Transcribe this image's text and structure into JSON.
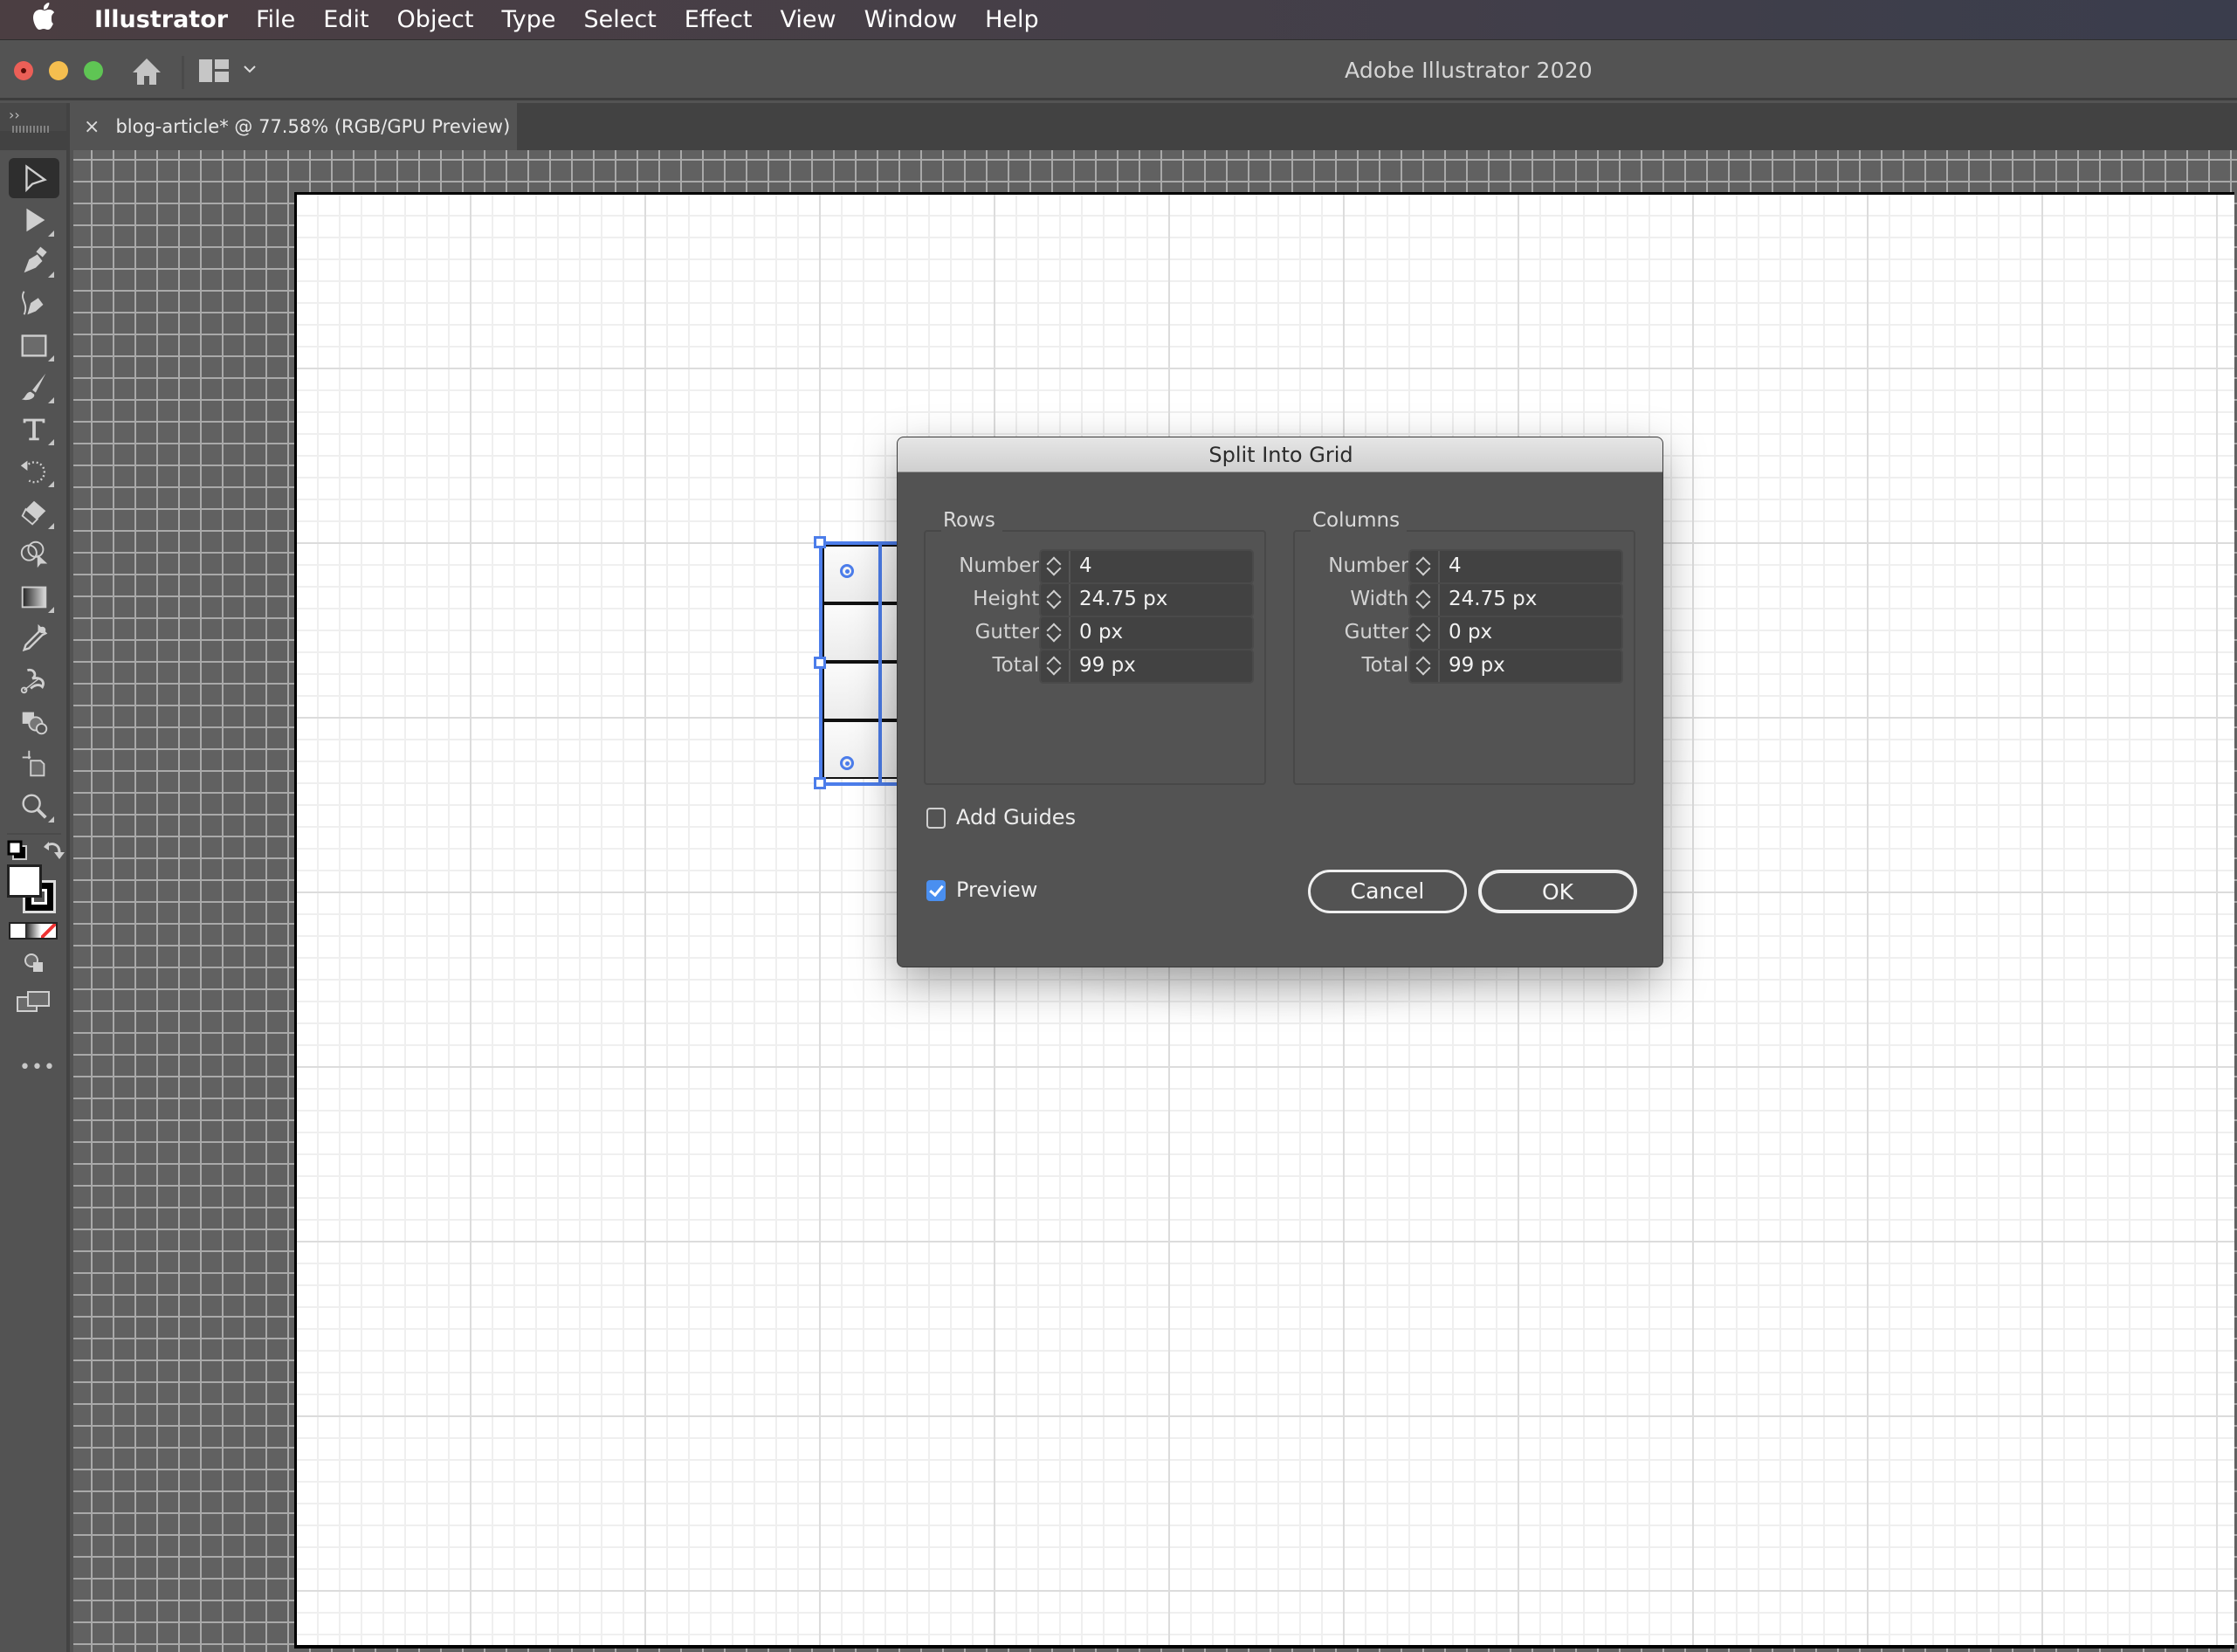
{
  "menubar": {
    "apple_icon": "apple-logo",
    "app_name": "Illustrator",
    "items": [
      "File",
      "Edit",
      "Object",
      "Type",
      "Select",
      "Effect",
      "View",
      "Window",
      "Help"
    ]
  },
  "titlebar": {
    "app_title": "Adobe Illustrator 2020",
    "icons": [
      "home-icon",
      "workspace-switcher-icon",
      "chevron-down-icon"
    ]
  },
  "tabs": {
    "collapse_label": "››",
    "document_tab": {
      "close_label": "×",
      "title": "blog-article* @ 77.58% (RGB/GPU Preview)"
    }
  },
  "toolbar": {
    "tools": [
      {
        "name": "selection-tool",
        "active": true
      },
      {
        "name": "direct-selection-tool",
        "active": false
      },
      {
        "name": "pen-tool",
        "active": false
      },
      {
        "name": "curvature-tool",
        "active": false
      },
      {
        "name": "rectangle-tool",
        "active": false
      },
      {
        "name": "paintbrush-tool",
        "active": false
      },
      {
        "name": "type-tool",
        "active": false
      },
      {
        "name": "rotate-tool",
        "active": false
      },
      {
        "name": "eraser-tool",
        "active": false
      },
      {
        "name": "shape-builder-tool",
        "active": false
      },
      {
        "name": "gradient-tool",
        "active": false
      },
      {
        "name": "eyedropper-tool",
        "active": false
      },
      {
        "name": "puppet-warp-tool",
        "active": false
      },
      {
        "name": "live-paint-tool",
        "active": false
      },
      {
        "name": "artboard-tool",
        "active": false
      },
      {
        "name": "zoom-tool",
        "active": false
      }
    ],
    "fill_color": "#ffffff",
    "stroke_color": "#000000",
    "more_label": "•••"
  },
  "canvas": {
    "selected_object": {
      "rows": 4,
      "columns": 4
    }
  },
  "dialog": {
    "title": "Split Into Grid",
    "rows": {
      "legend": "Rows",
      "fields": [
        {
          "label": "Number:",
          "value": "4"
        },
        {
          "label": "Height:",
          "value": "24.75 px"
        },
        {
          "label": "Gutter:",
          "value": "0 px"
        },
        {
          "label": "Total:",
          "value": "99 px"
        }
      ]
    },
    "columns": {
      "legend": "Columns",
      "fields": [
        {
          "label": "Number:",
          "value": "4"
        },
        {
          "label": "Width:",
          "value": "24.75 px"
        },
        {
          "label": "Gutter:",
          "value": "0 px"
        },
        {
          "label": "Total:",
          "value": "99 px"
        }
      ]
    },
    "add_guides": {
      "label": "Add Guides",
      "checked": false
    },
    "preview": {
      "label": "Preview",
      "checked": true
    },
    "cancel_label": "Cancel",
    "ok_label": "OK",
    "accent_color": "#4a8ff0"
  }
}
